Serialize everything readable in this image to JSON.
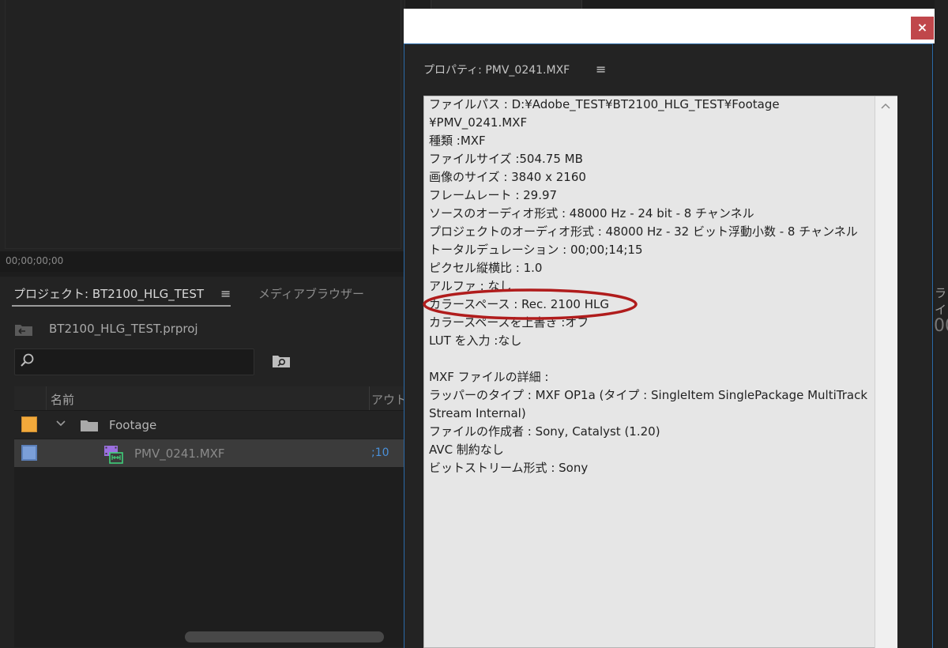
{
  "monitor": {
    "timecode": "00;00;00;00"
  },
  "right_edge": {
    "tab_fragment": "ライ",
    "digits": "00"
  },
  "project_panel": {
    "tab_label": "プロジェクト: BT2100_HLG_TEST",
    "tab_menu_glyph": "≡",
    "media_browser_tab": "メディアブラウザー",
    "project_file": "BT2100_HLG_TEST.prproj",
    "search": {
      "value": "",
      "placeholder": ""
    },
    "columns": {
      "name": "名前",
      "out": "アウトポイント"
    },
    "rows": [
      {
        "label": "Footage",
        "color": "#f2a93b",
        "type": "bin"
      },
      {
        "label": "PMV_0241.MXF",
        "color": "#7b9fd8",
        "type": "clip",
        "out": ";10"
      }
    ]
  },
  "dialog": {
    "close_glyph": "×",
    "title": "プロパティ: PMV_0241.MXF",
    "menu_glyph": "≡",
    "properties": [
      "ファイルパス : D:¥Adobe_TEST¥BT2100_HLG_TEST¥Footage",
      "¥PMV_0241.MXF",
      "種類 :MXF",
      "ファイルサイズ :504.75 MB",
      "画像のサイズ : 3840 x 2160",
      "フレームレート : 29.97",
      "ソースのオーディオ形式 : 48000 Hz - 24 bit - 8 チャンネル",
      "プロジェクトのオーディオ形式 : 48000 Hz - 32 ビット浮動小数 - 8 チャンネル",
      "トータルデュレーション : 00;00;14;15",
      "ピクセル縦横比 : 1.0",
      "アルファ : なし",
      "カラースペース : Rec. 2100 HLG",
      "カラースペースを上書き :オフ",
      "LUT を入力 :なし",
      "",
      "MXF ファイルの詳細 :",
      "ラッパーのタイプ : MXF OP1a (タイプ : SingleItem SinglePackage MultiTrack",
      "Stream Internal)",
      "ファイルの作成者 : Sony, Catalyst (1.20)",
      "AVC 制約なし",
      "ビットストリーム形式 : Sony"
    ],
    "highlight_color": "#b01c1c"
  }
}
